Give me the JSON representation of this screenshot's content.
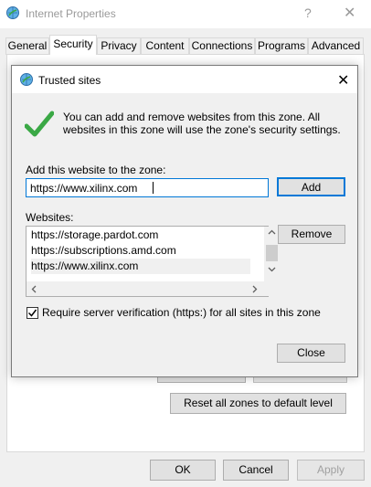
{
  "parent": {
    "title": "Internet Properties",
    "help_glyph": "?",
    "close_glyph": "✕",
    "tabs": [
      {
        "label": "General",
        "active": false
      },
      {
        "label": "Security",
        "active": true
      },
      {
        "label": "Privacy",
        "active": false
      },
      {
        "label": "Content",
        "active": false
      },
      {
        "label": "Connections",
        "active": false
      },
      {
        "label": "Programs",
        "active": false
      },
      {
        "label": "Advanced",
        "active": false
      }
    ],
    "reset_all_label": "Reset all zones to default level",
    "ok_label": "OK",
    "cancel_label": "Cancel",
    "apply_label": "Apply"
  },
  "dialog": {
    "title": "Trusted sites",
    "close_glyph": "✕",
    "description": "You can add and remove websites from this zone. All websites in this zone will use the zone's security settings.",
    "add_label": "Add this website to the zone:",
    "add_input_value": "https://www.xilinx.com",
    "add_button": "Add",
    "websites_label": "Websites:",
    "websites": [
      "https://storage.pardot.com",
      "https://subscriptions.amd.com",
      "https://www.xilinx.com"
    ],
    "remove_button": "Remove",
    "require_https_label": "Require server verification (https:) for all sites in this zone",
    "require_https_checked": true,
    "close_button": "Close"
  },
  "colors": {
    "accent": "#0078d7",
    "checkmark": "#3aa845"
  }
}
